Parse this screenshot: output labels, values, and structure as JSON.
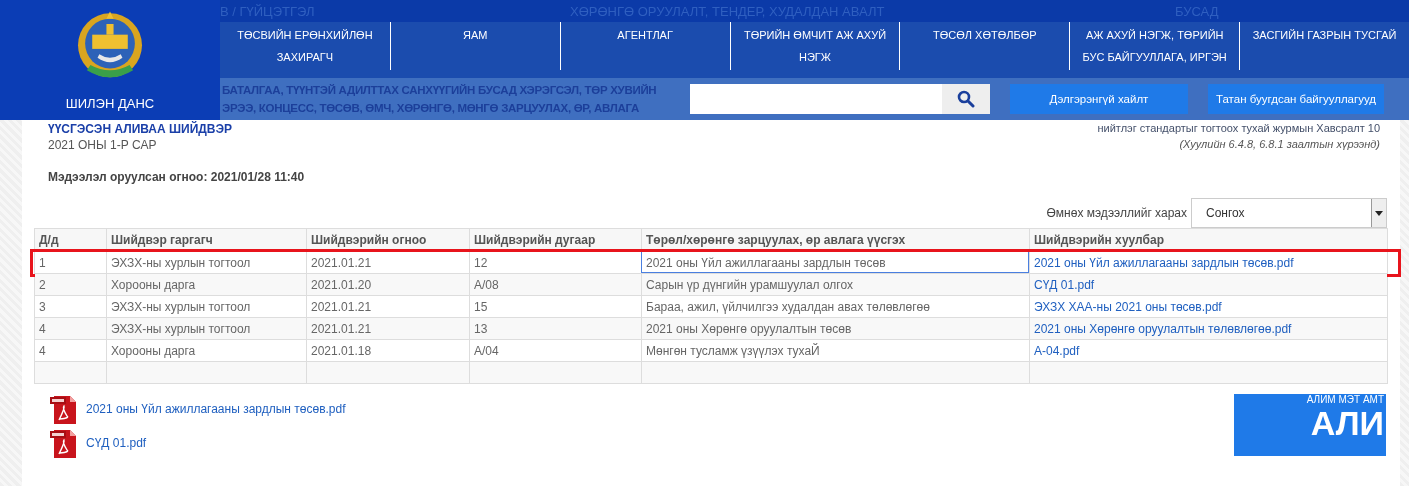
{
  "header": {
    "logo_text": "ШИЛЭН ДАНС",
    "ghost_nav": [
      "В / ГҮЙЦЭТГЭЛ",
      "ХӨРӨНГӨ ОРУУЛАЛТ, ТЕНДЕР, ХУДАЛДАН АВАЛТ",
      "БУСАД"
    ],
    "nav": [
      {
        "label": "ТӨСВИЙН ЕРӨНХИЙЛӨН ЗАХИРАГЧ"
      },
      {
        "label": "ЯАМ"
      },
      {
        "label": "АГЕНТЛАГ"
      },
      {
        "label": "ТӨРИЙН ӨМЧИТ АЖ АХУЙ НЭГЖ"
      },
      {
        "label": "ТӨСӨЛ ХӨТӨЛБӨР"
      },
      {
        "label": "АЖ АХУЙ НЭГЖ, ТӨРИЙН БУС БАЙГУУЛЛАГА, ИРГЭН"
      },
      {
        "label": "ЗАСГИЙН ГАЗРЫН ТУСГАЙ"
      }
    ],
    "ghost_lines": [
      "БАТАЛГАА, ТҮҮНТЭЙ АДИЛТТАХ САНХҮҮГИЙН БУСАД ХЭРЭГСЭЛ, ТӨР ХУВИЙН",
      "ЭРЭЭ, КОНЦЕСС, ТӨСӨВ, ӨМЧ, ХӨРӨНГӨ, МӨНГӨ ЗАРЦУУЛАХ, ӨР, АВЛАГА"
    ],
    "buttons": [
      "Дэлгэрэнгүй хайлт",
      "Татан буугдсан байгууллагууд"
    ]
  },
  "page": {
    "title": "ҮҮСГЭСЭН АЛИВАА ШИЙДВЭР",
    "period": "2021 ОНЫ 1-Р САР",
    "reference": "нийтлэг стандартыг тогтоох тухай журмын Хавсралт 10",
    "legal_note": "(Хуулийн 6.4.8, 6.8.1 заалтын хүрээнд)",
    "updated": "Мэдээлэл оруулсан огноо: 2021/01/28 11:40",
    "history": {
      "label": "Өмнөх мэдээллийг харах",
      "value": "Сонгох"
    }
  },
  "table": {
    "columns": [
      "Д/д",
      "Шийдвэр гаргагч",
      "Шийдвэрийн огноо",
      "Шийдвэрийн дугаар",
      "Төрөл/хөрөнгө зарцуулах, өр авлага үүсгэх",
      "Шийдвэрийн хуулбар"
    ],
    "rows": [
      {
        "cells": [
          "1",
          "ЭХЗХ-ны хурлын тогтоол",
          "2021.01.21",
          "12",
          "2021 оны Үйл ажиллагааны зардлын төсөв"
        ],
        "file": "2021 оны Үйл ажиллагааны зардлын төсөв.pdf",
        "highlighted": true
      },
      {
        "cells": [
          "2",
          "Хорооны дарга",
          "2021.01.20",
          "А/08",
          "Сарын үр дүнгийн урамшуулал олгох"
        ],
        "file": "СҮД 01.pdf",
        "highlighted": false
      },
      {
        "cells": [
          "3",
          "ЭХЗХ-ны хурлын тогтоол",
          "2021.01.21",
          "15",
          "Бараа, ажил, үйлчилгээ худалдан авах төлөвлөгөө"
        ],
        "file": "ЭХЗХ ХАА-ны 2021 оны төсөв.pdf",
        "highlighted": false
      },
      {
        "cells": [
          "4",
          "ЭХЗХ-ны хурлын тогтоол",
          "2021.01.21",
          "13",
          "2021 оны Хөрөнгө оруулалтын төсөв"
        ],
        "file": "2021 оны Хөрөнгө оруулалтын төлөвлөгөө.pdf",
        "highlighted": false
      },
      {
        "cells": [
          "4",
          "Хорооны дарга",
          "2021.01.18",
          "А/04",
          "Мөнгөн тусламж үзүүлэх тухаЙ"
        ],
        "file": "А-04.pdf",
        "highlighted": false
      }
    ]
  },
  "files": [
    "2021 оны Үйл ажиллагааны зардлын төсөв.pdf",
    "СҮД 01.pdf"
  ],
  "banner": {
    "lines": [
      "АЛИМ МЭТ АМТ",
      "АЛИ"
    ]
  }
}
